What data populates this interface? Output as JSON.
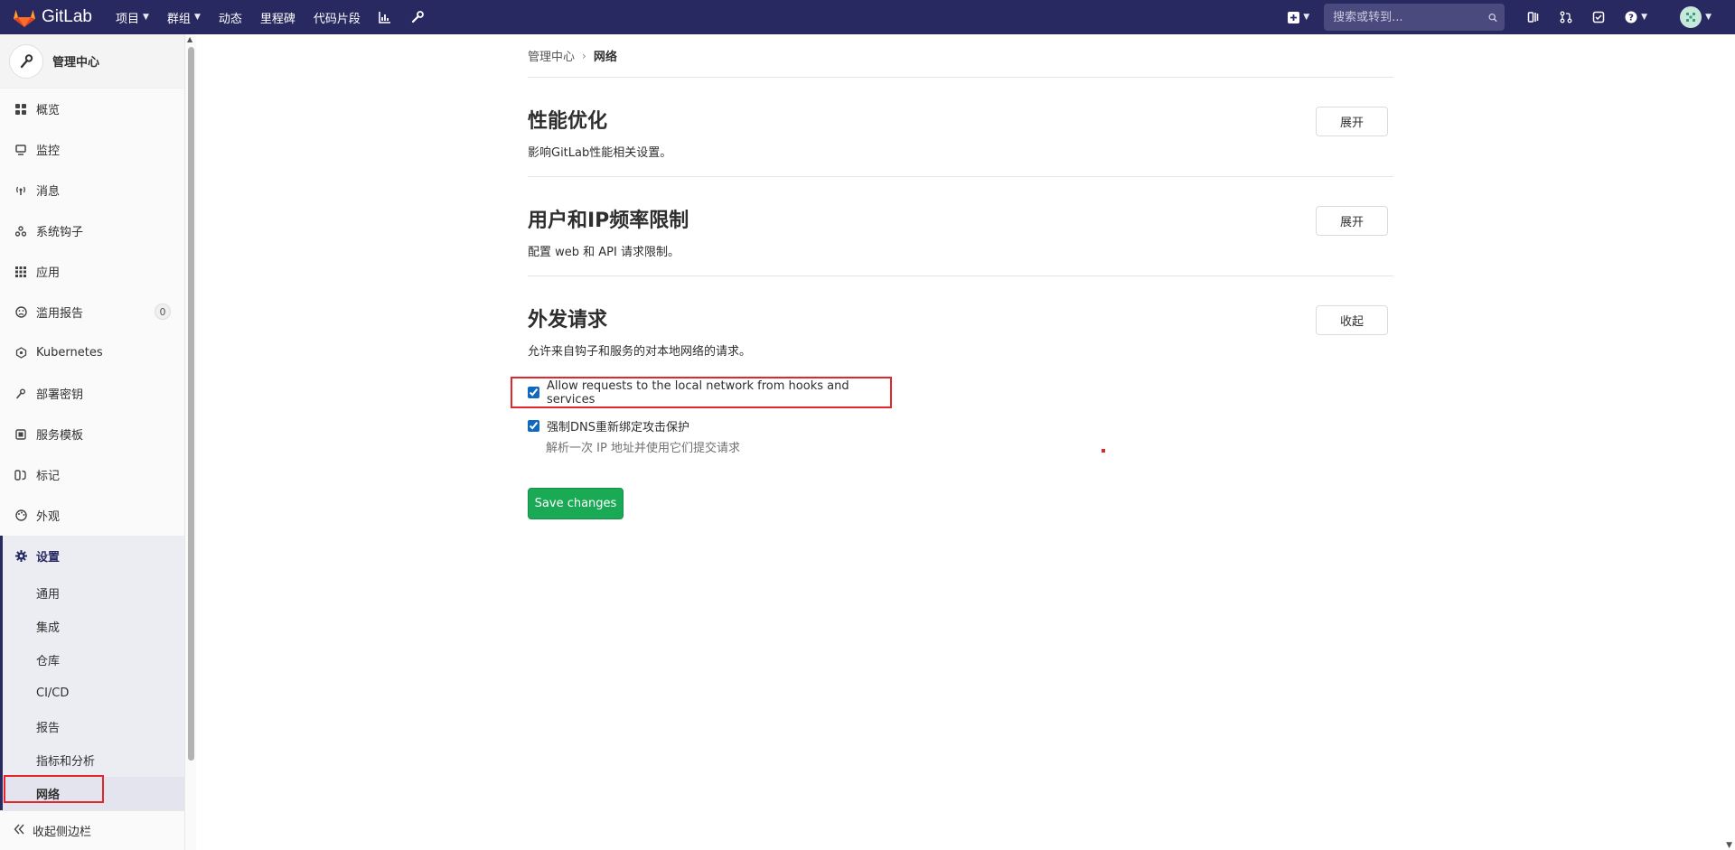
{
  "navbar": {
    "brand": "GitLab",
    "links": [
      {
        "label": "项目",
        "dropdown": true
      },
      {
        "label": "群组",
        "dropdown": true
      },
      {
        "label": "动态",
        "dropdown": false
      },
      {
        "label": "里程碑",
        "dropdown": false
      },
      {
        "label": "代码片段",
        "dropdown": false
      }
    ],
    "search_placeholder": "搜索或转到...",
    "brand_color": "#292961"
  },
  "sidebar": {
    "title": "管理中心",
    "items": [
      {
        "label": "概览",
        "icon": "grid-icon"
      },
      {
        "label": "监控",
        "icon": "monitor-icon"
      },
      {
        "label": "消息",
        "icon": "broadcast-icon"
      },
      {
        "label": "系统钩子",
        "icon": "hook-icon"
      },
      {
        "label": "应用",
        "icon": "apps-icon"
      },
      {
        "label": "滥用报告",
        "icon": "abuse-icon",
        "badge": "0"
      },
      {
        "label": "Kubernetes",
        "icon": "kubernetes-icon"
      },
      {
        "label": "部署密钥",
        "icon": "key-icon"
      },
      {
        "label": "服务模板",
        "icon": "template-icon"
      },
      {
        "label": "标记",
        "icon": "labels-icon"
      },
      {
        "label": "外观",
        "icon": "appearance-icon"
      }
    ],
    "settings": {
      "label": "设置",
      "subitems": [
        "通用",
        "集成",
        "仓库",
        "CI/CD",
        "报告",
        "指标和分析",
        "网络"
      ],
      "active": "网络"
    },
    "collapse_label": "收起侧边栏"
  },
  "breadcrumb": {
    "parent": "管理中心",
    "current": "网络"
  },
  "sections": [
    {
      "title": "性能优化",
      "desc": "影响GitLab性能相关设置。",
      "button": "展开"
    },
    {
      "title": "用户和IP频率限制",
      "desc": "配置 web 和 API 请求限制。",
      "button": "展开"
    },
    {
      "title": "外发请求",
      "desc": "允许来自钩子和服务的对本地网络的请求。",
      "button": "收起"
    }
  ],
  "outbound": {
    "allow_local_label": "Allow requests to the local network from hooks and services",
    "allow_local_checked": true,
    "dns_label": "强制DNS重新绑定攻击保护",
    "dns_checked": true,
    "dns_help": "解析一次 IP 地址并使用它们提交请求",
    "save_label": "Save changes"
  },
  "colors": {
    "save_green": "#1aaa55",
    "highlight_red": "#e3262a"
  }
}
